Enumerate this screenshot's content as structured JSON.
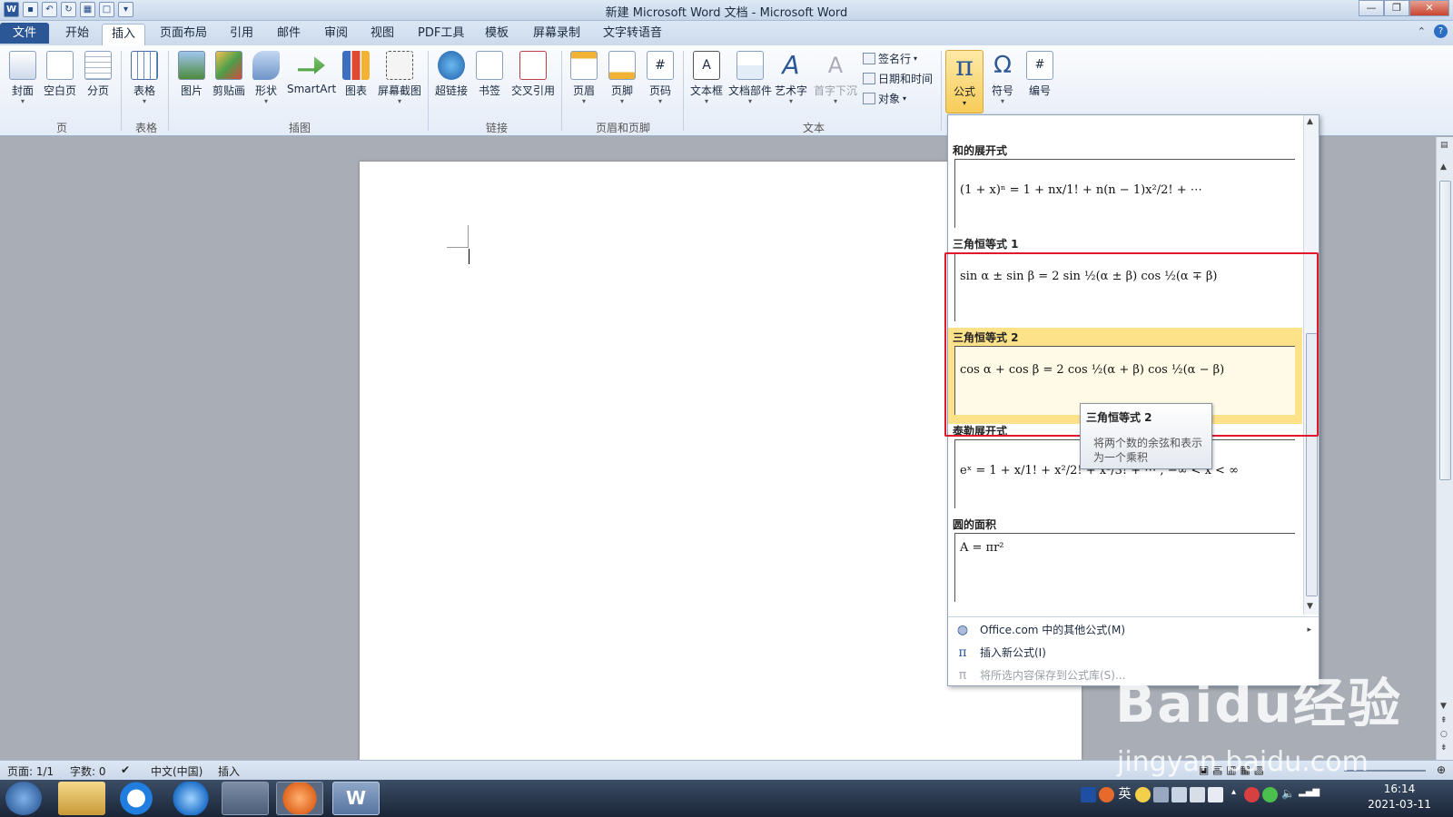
{
  "window": {
    "title": "新建 Microsoft Word 文档 - Microsoft Word"
  },
  "tabs": {
    "file": "文件",
    "home": "开始",
    "insert": "插入",
    "layout": "页面布局",
    "references": "引用",
    "mailings": "邮件",
    "review": "审阅",
    "view": "视图",
    "pdf": "PDF工具",
    "template": "模板",
    "screenrec": "屏幕录制",
    "tts": "文字转语音"
  },
  "ribbon": {
    "cover": "封面",
    "blank": "空白页",
    "pagebreak": "分页",
    "table": "表格",
    "picture": "图片",
    "clipart": "剪贴画",
    "shapes": "形状",
    "smartart": "SmartArt",
    "chart": "图表",
    "screenshot": "屏幕截图",
    "hyperlink": "超链接",
    "bookmark": "书签",
    "crossref": "交叉引用",
    "header": "页眉",
    "footer": "页脚",
    "pagenum": "页码",
    "textbox": "文本框",
    "quickparts": "文档部件",
    "wordart": "艺术字",
    "dropcap": "首字下沉",
    "signature": "签名行",
    "datetime": "日期和时间",
    "object": "对象",
    "equation": "公式",
    "symbol": "符号",
    "number": "编号",
    "groups": {
      "pages": "页",
      "tables": "表格",
      "illustrations": "插图",
      "links": "链接",
      "headerfooter": "页眉和页脚",
      "text": "文本"
    }
  },
  "gallery": {
    "items": [
      {
        "title": "和的展开式",
        "eq": "(1 + x)ⁿ = 1 + nx/1! + n(n − 1)x²/2! + ⋯"
      },
      {
        "title": "三角恒等式 1",
        "eq": "sin α ± sin β = 2 sin ½(α ± β) cos ½(α ∓ β)"
      },
      {
        "title": "三角恒等式 2",
        "eq": "cos α + cos β = 2 cos ½(α + β) cos ½(α − β)"
      },
      {
        "title": "泰勒展开式",
        "eq": "eˣ = 1 + x/1! + x²/2! + x³/3! + ⋯ ,    −∞ < x < ∞"
      },
      {
        "title": "圆的面积",
        "eq": "A = πr²"
      }
    ],
    "menu": {
      "more": "Office.com 中的其他公式(M)",
      "insert_new": "插入新公式(I)",
      "save_selection": "将所选内容保存到公式库(S)..."
    }
  },
  "tooltip": {
    "title": "三角恒等式 2",
    "desc": "将两个数的余弦和表示为一个乘积"
  },
  "status": {
    "page": "页面: 1/1",
    "words": "字数: 0",
    "lang": "中文(中国)",
    "mode": "插入"
  },
  "clock": {
    "time": "16:14",
    "date": "2021-03-11"
  },
  "tray": {
    "ime": "英"
  },
  "watermark": {
    "brand": "Baidu经验",
    "url": "jingyan.baidu.com"
  },
  "colors": {
    "accent": "#2b5797",
    "highlight": "#fde28a",
    "redbox": "#e0182a"
  }
}
